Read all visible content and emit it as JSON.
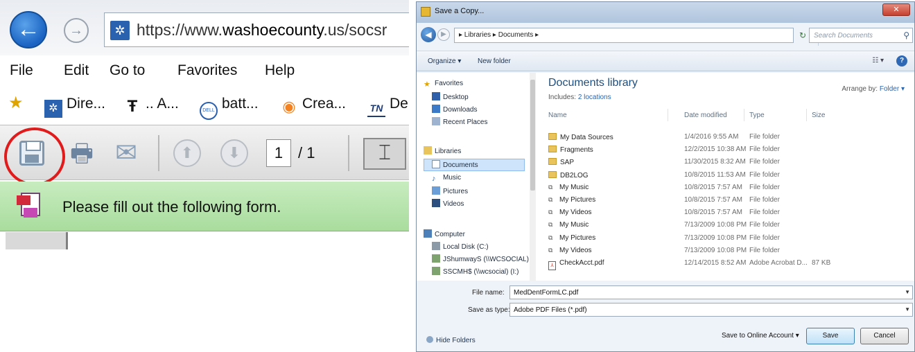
{
  "browser": {
    "back_glyph": "←",
    "forward_glyph": "→",
    "site_icon_glyph": "✲",
    "address_prefix": "https://www.",
    "address_domain": "washoecounty",
    "address_suffix": ".us/socsr",
    "menu": [
      "File",
      "Edit",
      "Go to",
      "Favorites",
      "Help"
    ],
    "favorites": [
      {
        "label": "Dire...",
        "icon": "washoe-seal-icon",
        "glyph": "✲"
      },
      {
        "label": ".. A...",
        "icon": "tf-logo-icon",
        "glyph": "Ŧ"
      },
      {
        "label": "batt...",
        "icon": "dell-logo-icon",
        "glyph": "DELL"
      },
      {
        "label": "Crea...",
        "icon": "orange-logo-icon",
        "glyph": "◉"
      },
      {
        "label": "De",
        "icon": "tn-logo-icon",
        "glyph": "TN"
      }
    ],
    "star_glyph": "★",
    "print_glyph": "🖶",
    "email_glyph": "✉",
    "up_glyph": "⬆",
    "down_glyph": "⬇",
    "page_current": "1",
    "page_total": "/ 1",
    "select_glyph": "⌶",
    "form_message": "Please fill out the following form."
  },
  "dialog": {
    "title": "Save a Copy...",
    "close_glyph": "✕",
    "breadcrumb": "▸ Libraries ▸ Documents ▸",
    "search_placeholder": "Search Documents",
    "search_glyph": "⚲",
    "refresh_glyph": "↻",
    "toolbar": {
      "organize": "Organize ▾",
      "new_folder": "New folder",
      "view_glyph": "☷ ▾",
      "help_glyph": "?"
    },
    "nav": {
      "favorites": "Favorites",
      "desktop": "Desktop",
      "downloads": "Downloads",
      "recent": "Recent Places",
      "libraries": "Libraries",
      "documents": "Documents",
      "music": "Music",
      "pictures": "Pictures",
      "videos": "Videos",
      "computer": "Computer",
      "local_disk": "Local Disk (C:)",
      "share1": "JShumwayS (\\\\WCSOCIAL) (H",
      "share2": "SSCMH$ (\\\\wcsocial) (I:)"
    },
    "library_title": "Documents library",
    "library_includes_prefix": "Includes:",
    "library_includes_link": "2 locations",
    "arrange_label": "Arrange by:",
    "arrange_value": "Folder ▾",
    "columns": {
      "name": "Name",
      "date": "Date modified",
      "type": "Type",
      "size": "Size"
    },
    "files": [
      {
        "name": "My Data Sources",
        "date": "1/4/2016 9:55 AM",
        "type": "File folder",
        "size": "",
        "kind": "folder"
      },
      {
        "name": "Fragments",
        "date": "12/2/2015 10:38 AM",
        "type": "File folder",
        "size": "",
        "kind": "folder"
      },
      {
        "name": "SAP",
        "date": "11/30/2015 8:32 AM",
        "type": "File folder",
        "size": "",
        "kind": "folder"
      },
      {
        "name": "DB2LOG",
        "date": "10/8/2015 11:53 AM",
        "type": "File folder",
        "size": "",
        "kind": "folder"
      },
      {
        "name": "My Music",
        "date": "10/8/2015 7:57 AM",
        "type": "File folder",
        "size": "",
        "kind": "link"
      },
      {
        "name": "My Pictures",
        "date": "10/8/2015 7:57 AM",
        "type": "File folder",
        "size": "",
        "kind": "link"
      },
      {
        "name": "My Videos",
        "date": "10/8/2015 7:57 AM",
        "type": "File folder",
        "size": "",
        "kind": "link"
      },
      {
        "name": "My Music",
        "date": "7/13/2009 10:08 PM",
        "type": "File folder",
        "size": "",
        "kind": "link"
      },
      {
        "name": "My Pictures",
        "date": "7/13/2009 10:08 PM",
        "type": "File folder",
        "size": "",
        "kind": "link"
      },
      {
        "name": "My Videos",
        "date": "7/13/2009 10:08 PM",
        "type": "File folder",
        "size": "",
        "kind": "link"
      },
      {
        "name": "CheckAcct.pdf",
        "date": "12/14/2015 8:52 AM",
        "type": "Adobe Acrobat D...",
        "size": "87 KB",
        "kind": "pdf"
      }
    ],
    "file_name_label": "File name:",
    "file_name_value": "MedDentFormLC.pdf",
    "save_type_label": "Save as type:",
    "save_type_value": "Adobe PDF Files (*.pdf)",
    "hide_folders": "Hide Folders",
    "save_online": "Save to Online Account ▾",
    "save_button": "Save",
    "cancel_button": "Cancel"
  },
  "colors": {
    "highlight_circle": "#e11b1b",
    "form_bar": "#b5e2aa",
    "library_title": "#1d4e80"
  }
}
